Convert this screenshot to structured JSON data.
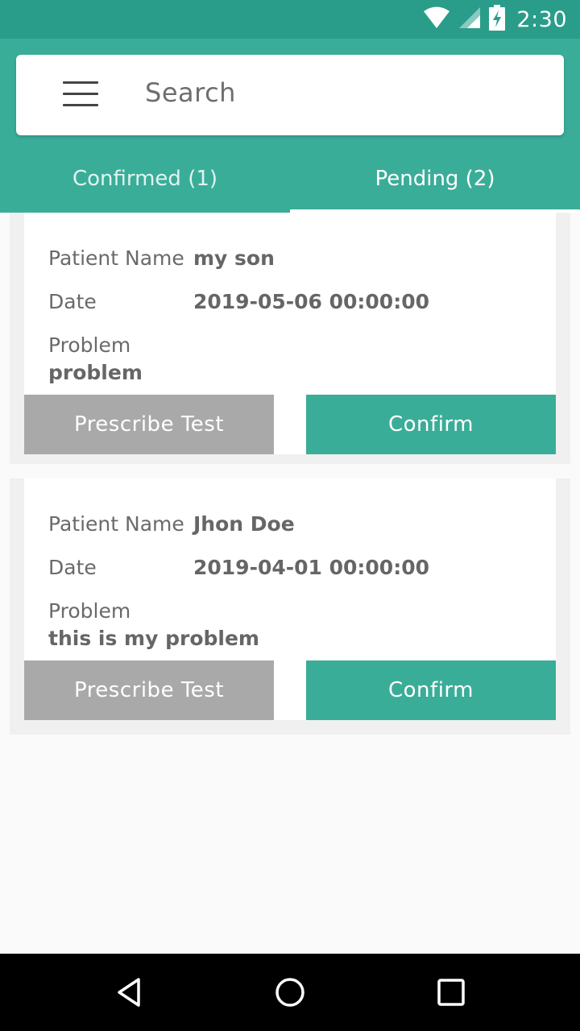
{
  "status_bar": {
    "time": "2:30",
    "icons": [
      "wifi-icon",
      "signal-icon",
      "battery-charging-icon"
    ]
  },
  "search": {
    "placeholder": "Search"
  },
  "tabs": [
    {
      "label": "Confirmed (1)",
      "active": false
    },
    {
      "label": "Pending (2)",
      "active": true
    }
  ],
  "labels": {
    "patient_name": "Patient Name",
    "date": "Date",
    "problem": "Problem",
    "prescribe": "Prescribe Test",
    "confirm": "Confirm"
  },
  "appointments": [
    {
      "patient_name": "my son",
      "date": "2019-05-06 00:00:00",
      "problem": "problem"
    },
    {
      "patient_name": "Jhon Doe",
      "date": "2019-04-01 00:00:00",
      "problem": "this is my problem"
    }
  ],
  "colors": {
    "primary": "#3aad99",
    "status_bar": "#2a9d8a",
    "secondary_button": "#a9a9a9"
  },
  "nav": [
    "back-icon",
    "home-icon",
    "recents-icon"
  ]
}
